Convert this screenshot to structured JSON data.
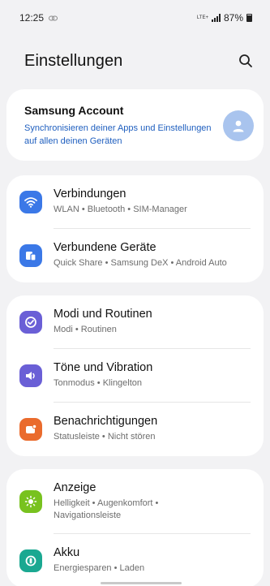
{
  "status": {
    "time": "12:25",
    "network": "LTE+",
    "battery": "87%"
  },
  "header": {
    "title": "Einstellungen"
  },
  "account": {
    "title": "Samsung Account",
    "subtitle": "Synchronisieren deiner Apps und Einstellungen auf allen deinen Geräten"
  },
  "groups": [
    {
      "items": [
        {
          "title": "Verbindungen",
          "subtitle": "WLAN • Bluetooth • SIM-Manager",
          "icon": "wifi-icon",
          "color": "#3b78e7"
        },
        {
          "title": "Verbundene Geräte",
          "subtitle": "Quick Share • Samsung DeX • Android Auto",
          "icon": "devices-icon",
          "color": "#3b78e7"
        }
      ]
    },
    {
      "items": [
        {
          "title": "Modi und Routinen",
          "subtitle": "Modi • Routinen",
          "icon": "routines-icon",
          "color": "#6a5fd6"
        },
        {
          "title": "Töne und Vibration",
          "subtitle": "Tonmodus • Klingelton",
          "icon": "speaker-icon",
          "color": "#6a5fd6"
        },
        {
          "title": "Benachrichtigungen",
          "subtitle": "Statusleiste • Nicht stören",
          "icon": "notification-icon",
          "color": "#ea6b2d"
        }
      ]
    },
    {
      "items": [
        {
          "title": "Anzeige",
          "subtitle": "Helligkeit • Augenkomfort • Navigationsleiste",
          "icon": "brightness-icon",
          "color": "#78c21f"
        },
        {
          "title": "Akku",
          "subtitle": "Energiesparen • Laden",
          "icon": "battery-icon",
          "color": "#1aa891"
        }
      ]
    }
  ]
}
